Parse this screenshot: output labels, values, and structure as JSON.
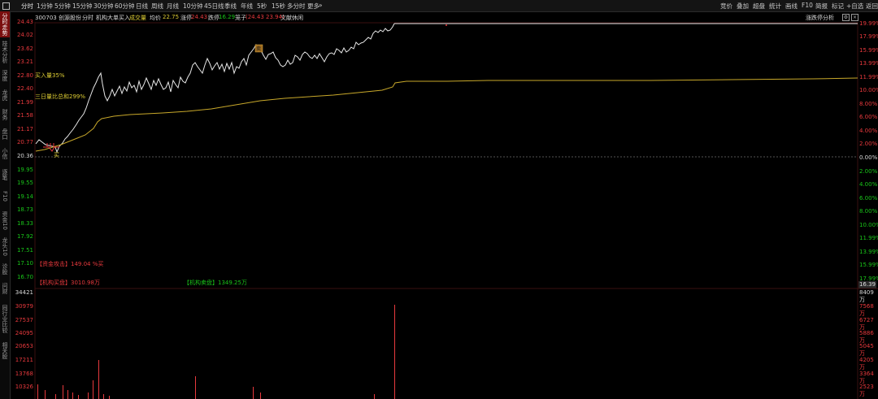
{
  "toolbar": {
    "tabs": [
      "分时",
      "1分钟",
      "5分钟",
      "15分钟",
      "30分钟",
      "60分钟",
      "日线",
      "周线",
      "月线",
      "10分钟",
      "45日线",
      "季线",
      "年线",
      "5秒",
      "15秒",
      "多分时",
      "更多"
    ],
    "right": [
      "竞价",
      "叠加",
      "超盘",
      "统计",
      "画线",
      "F10",
      "简报",
      "标记",
      "+自选",
      "返回"
    ]
  },
  "left_tabs": [
    "分时走势",
    "技术分析",
    "深度",
    "龙虎",
    "财务",
    "盘口",
    "小信",
    "逐笔",
    "F10",
    "资金10",
    "龙头10",
    "诊股",
    "问财",
    "同行业比较",
    "相关股"
  ],
  "info": {
    "code_name": "300703 创源股份",
    "mode": "分时",
    "indicator": "机构大单买入",
    "volume_label": "成交量",
    "avg_label": "均价",
    "avg_value": "22.75",
    "up_limit_label": "涨停",
    "up_limit_value": "24.43",
    "down_limit_label": "跌停",
    "down_limit_value": "16.29",
    "cursor_label": "笼子",
    "cursor_value": "(24.43 23.94)",
    "status": "文献休闲",
    "zt_analysis": "涨跌停分析"
  },
  "left_axis": [
    "24.43",
    "24.02",
    "23.62",
    "23.21",
    "22.80",
    "22.40",
    "21.99",
    "21.58",
    "21.17",
    "20.77",
    "20.36",
    "19.95",
    "19.55",
    "19.14",
    "18.73",
    "18.33",
    "17.92",
    "17.51",
    "17.10",
    "16.70"
  ],
  "right_axis": [
    "19.99%",
    "17.99%",
    "15.99%",
    "13.99%",
    "11.99%",
    "10.00%",
    "8.00%",
    "6.00%",
    "4.00%",
    "2.00%",
    "0.00%",
    "2.00%",
    "4.00%",
    "6.00%",
    "8.00%",
    "10.00%",
    "11.99%",
    "13.99%",
    "15.99%",
    "17.99%"
  ],
  "last_price": "16.39",
  "vol_left_axis": [
    "34421",
    "30979",
    "27537",
    "24095",
    "20653",
    "17211",
    "13768",
    "10326"
  ],
  "vol_right_axis": [
    "8409万",
    "7568万",
    "6727万",
    "5886万",
    "5045万",
    "4205万",
    "3364万",
    "2523万"
  ],
  "annotations": {
    "buy_ratio": "买入量35%",
    "three_day": "三日量比总和299%",
    "buy_mark": "买",
    "sell_mark": "卖",
    "capital_attack": "【资金攻击】149.04 %买",
    "inst_buy": "【机构买盘】3010.98万",
    "inst_sell": "【机构卖盘】1349.25万"
  },
  "colors": {
    "up": "#e8393d",
    "down": "#19c419",
    "price_line": "#e8e8e8",
    "avg_line": "#c8a82a",
    "bg": "#000000"
  }
}
